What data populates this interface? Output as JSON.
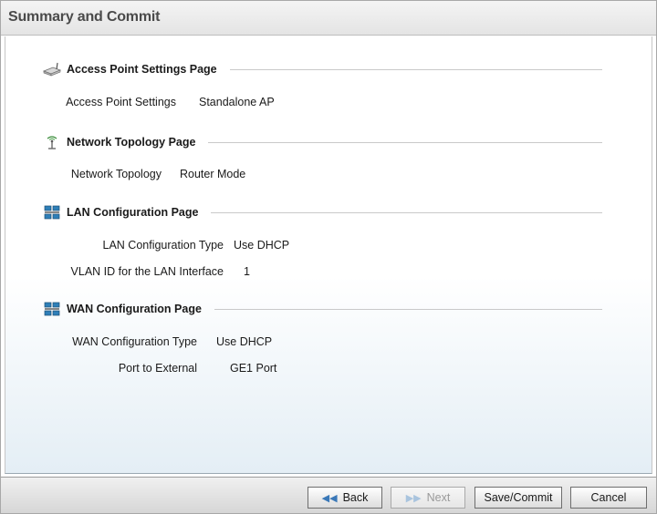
{
  "title": "Summary and Commit",
  "sections": [
    {
      "heading": "Access Point Settings Page",
      "icon": "access-point-icon",
      "rows": [
        {
          "key": "Access Point Settings",
          "value": "Standalone AP"
        }
      ]
    },
    {
      "heading": "Network Topology Page",
      "icon": "antenna-icon",
      "rows": [
        {
          "key": "Network Topology",
          "value": "Router Mode"
        }
      ]
    },
    {
      "heading": "LAN Configuration Page",
      "icon": "network-icon",
      "rows": [
        {
          "key": "LAN Configuration Type",
          "value": "Use DHCP"
        },
        {
          "key": "VLAN ID for the LAN Interface",
          "value": "1"
        }
      ]
    },
    {
      "heading": "WAN Configuration Page",
      "icon": "network-icon",
      "rows": [
        {
          "key": "WAN Configuration Type",
          "value": "Use DHCP"
        },
        {
          "key": "Port to External",
          "value": "GE1 Port"
        }
      ]
    }
  ],
  "buttons": {
    "back": "Back",
    "next": "Next",
    "save_commit": "Save/Commit",
    "cancel": "Cancel"
  }
}
